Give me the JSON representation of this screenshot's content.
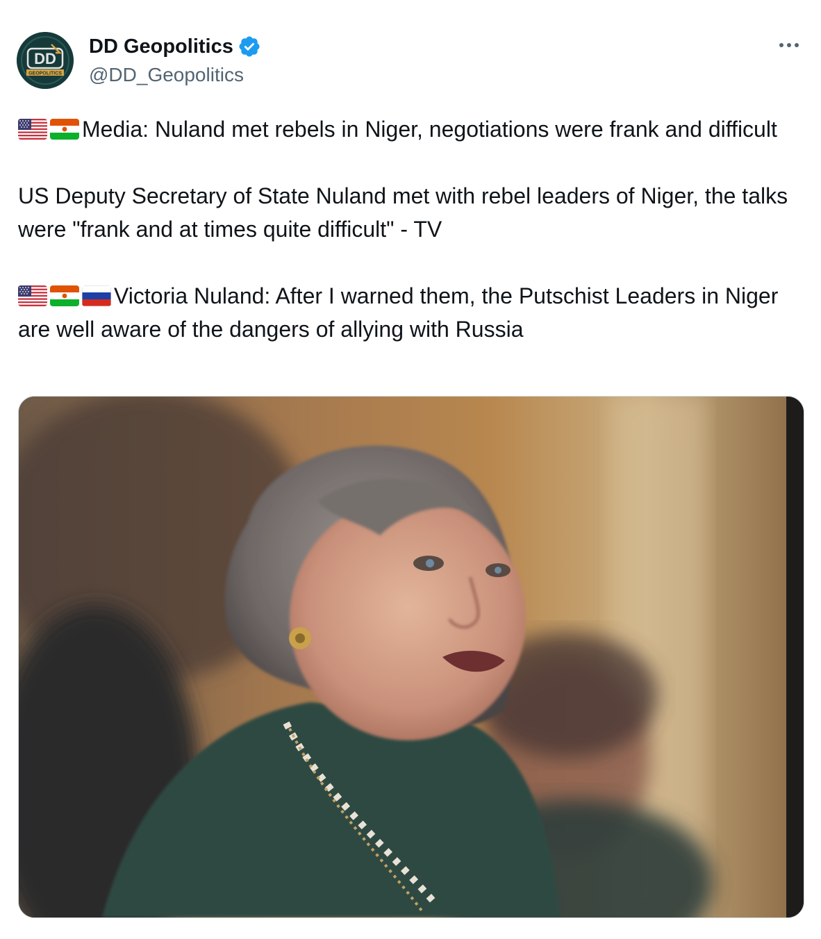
{
  "author": {
    "display_name": "DD Geopolitics",
    "handle": "@DD_Geopolitics",
    "verified": true,
    "avatar_monogram": "DD",
    "avatar_subtext": "GEOPOLITICS"
  },
  "header": {
    "more_icon": "more-horizontal-icon"
  },
  "tweet": {
    "paragraph_1_flags": [
      "flag-us",
      "flag-niger"
    ],
    "paragraph_1": "Media: Nuland met rebels in Niger, negotiations were frank and difficult",
    "paragraph_2": "US Deputy Secretary of State Nuland met with rebel leaders of Niger, the talks were \"frank and at times quite difficult\" - TV",
    "paragraph_3_flags": [
      "flag-us",
      "flag-niger",
      "flag-russia"
    ],
    "paragraph_3": "Victoria Nuland: After I warned them, the Putschist Leaders in Niger are well aware of the dangers of allying with Russia"
  },
  "colors": {
    "text": "#0f1419",
    "secondary": "#536471",
    "verified": "#1d9bf0",
    "border": "#cfd9de",
    "avatar_bg": "#163a3a",
    "avatar_gold": "#d9a441"
  }
}
